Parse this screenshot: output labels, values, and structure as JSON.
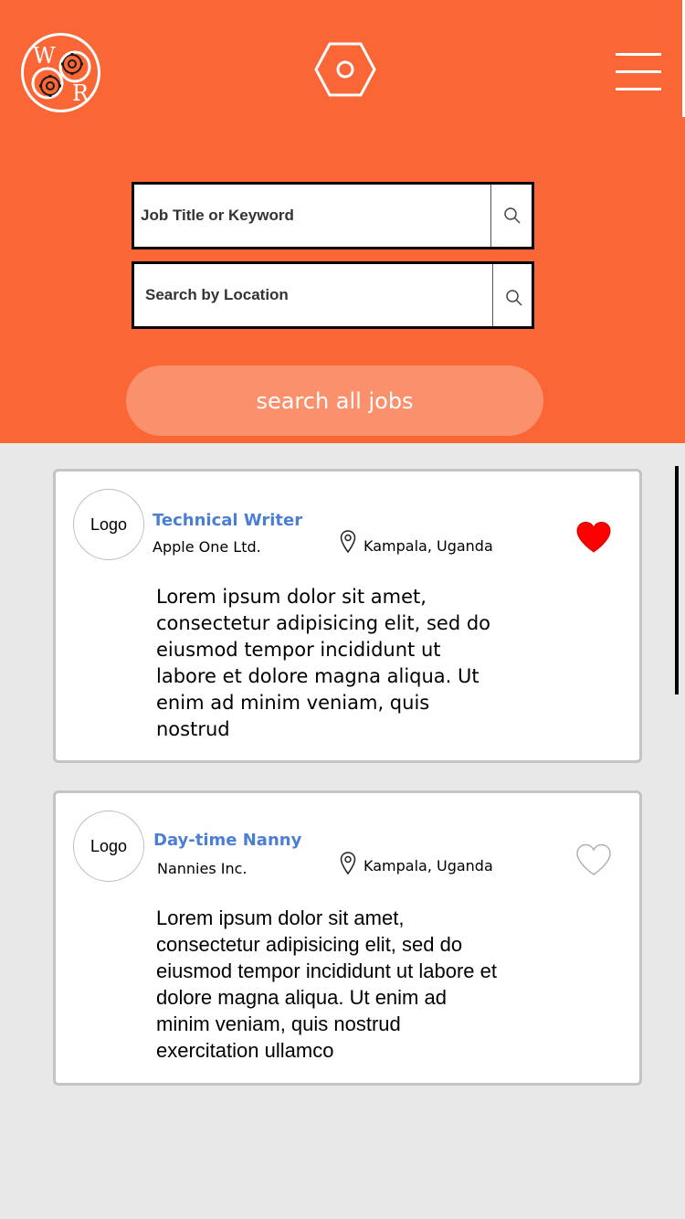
{
  "header": {
    "logo_letters": [
      "W",
      "R"
    ],
    "logo_icon": "gears-logo-icon",
    "center_icon": "hexagon-icon",
    "menu_icon": "hamburger-menu-icon",
    "accent_color": "#fb6636"
  },
  "search": {
    "keyword_placeholder": "Job Title or Keyword",
    "location_placeholder": "Search by Location",
    "search_icon": "search-icon",
    "search_all_label": "search all jobs"
  },
  "jobs": [
    {
      "logo_label": "Logo",
      "title": "Technical Writer",
      "company": "Apple One Ltd.",
      "location": "Kampala, Uganda",
      "favorited": true,
      "description": "Lorem ipsum dolor sit amet, consectetur adipisicing elit, sed do eiusmod tempor incididunt ut labore et dolore magna aliqua. Ut enim ad minim veniam, quis nostrud"
    },
    {
      "logo_label": "Logo",
      "title": "Day-time Nanny",
      "company": "Nannies Inc.",
      "location": "Kampala, Uganda",
      "favorited": false,
      "description": "Lorem ipsum dolor sit amet, consectetur adipisicing elit, sed do eiusmod tempor incididunt ut labore et dolore magna aliqua. Ut enim ad minim veniam, quis nostrud exercitation ullamco"
    }
  ],
  "colors": {
    "favorite_active": "#ff0000",
    "job_title": "#4a7fd4",
    "search_button": "#fb906c"
  }
}
